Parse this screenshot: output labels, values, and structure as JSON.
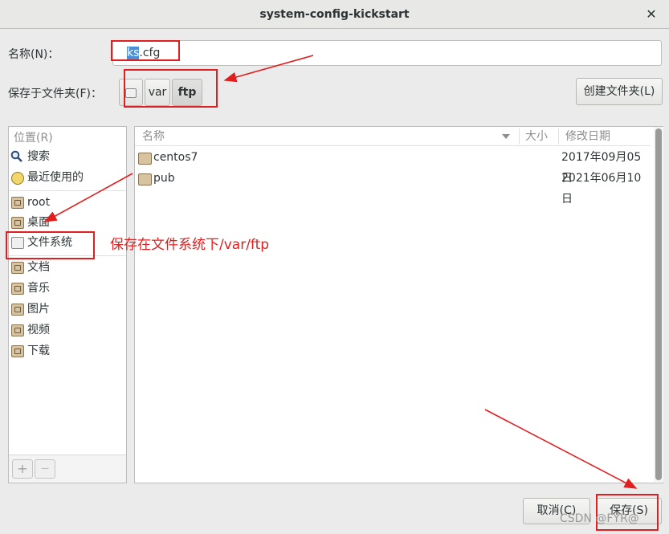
{
  "window": {
    "title": "system-config-kickstart",
    "close_glyph": "✕"
  },
  "name_field": {
    "label": "名称(N)：",
    "value_selected": "ks",
    "value_rest": ".cfg"
  },
  "save_in": {
    "label": "保存于文件夹(F)：",
    "path": [
      {
        "label": "",
        "icon": "drive-icon"
      },
      {
        "label": "var"
      },
      {
        "label": "ftp"
      }
    ],
    "create_folder_label": "创建文件夹(L)"
  },
  "sidebar": {
    "header": "位置(R)",
    "items": [
      {
        "label": "搜索",
        "icon": "search-icon"
      },
      {
        "label": "最近使用的",
        "icon": "recent-icon"
      },
      {
        "label": "root",
        "icon": "folder-home-icon"
      },
      {
        "label": "桌面",
        "icon": "folder-desktop-icon"
      },
      {
        "label": "文件系统",
        "icon": "drive-icon"
      },
      {
        "label": "文档",
        "icon": "folder-documents-icon"
      },
      {
        "label": "音乐",
        "icon": "folder-music-icon"
      },
      {
        "label": "图片",
        "icon": "folder-pictures-icon"
      },
      {
        "label": "视频",
        "icon": "folder-videos-icon"
      },
      {
        "label": "下载",
        "icon": "folder-downloads-icon"
      }
    ],
    "add_label": "+",
    "remove_label": "—"
  },
  "file_list": {
    "columns": {
      "name": "名称",
      "size": "大小",
      "modified": "修改日期"
    },
    "rows": [
      {
        "name": "centos7",
        "size": "",
        "modified": "2017年09月05日",
        "icon": "folder-icon"
      },
      {
        "name": "pub",
        "size": "",
        "modified": "2021年06月10日",
        "icon": "folder-icon"
      }
    ]
  },
  "buttons": {
    "cancel": "取消(C)",
    "save": "保存(S)"
  },
  "annotation": {
    "text": "保存在文件系统下/var/ftp",
    "color": "#e02020"
  },
  "watermark": "CSDN @FYR@"
}
